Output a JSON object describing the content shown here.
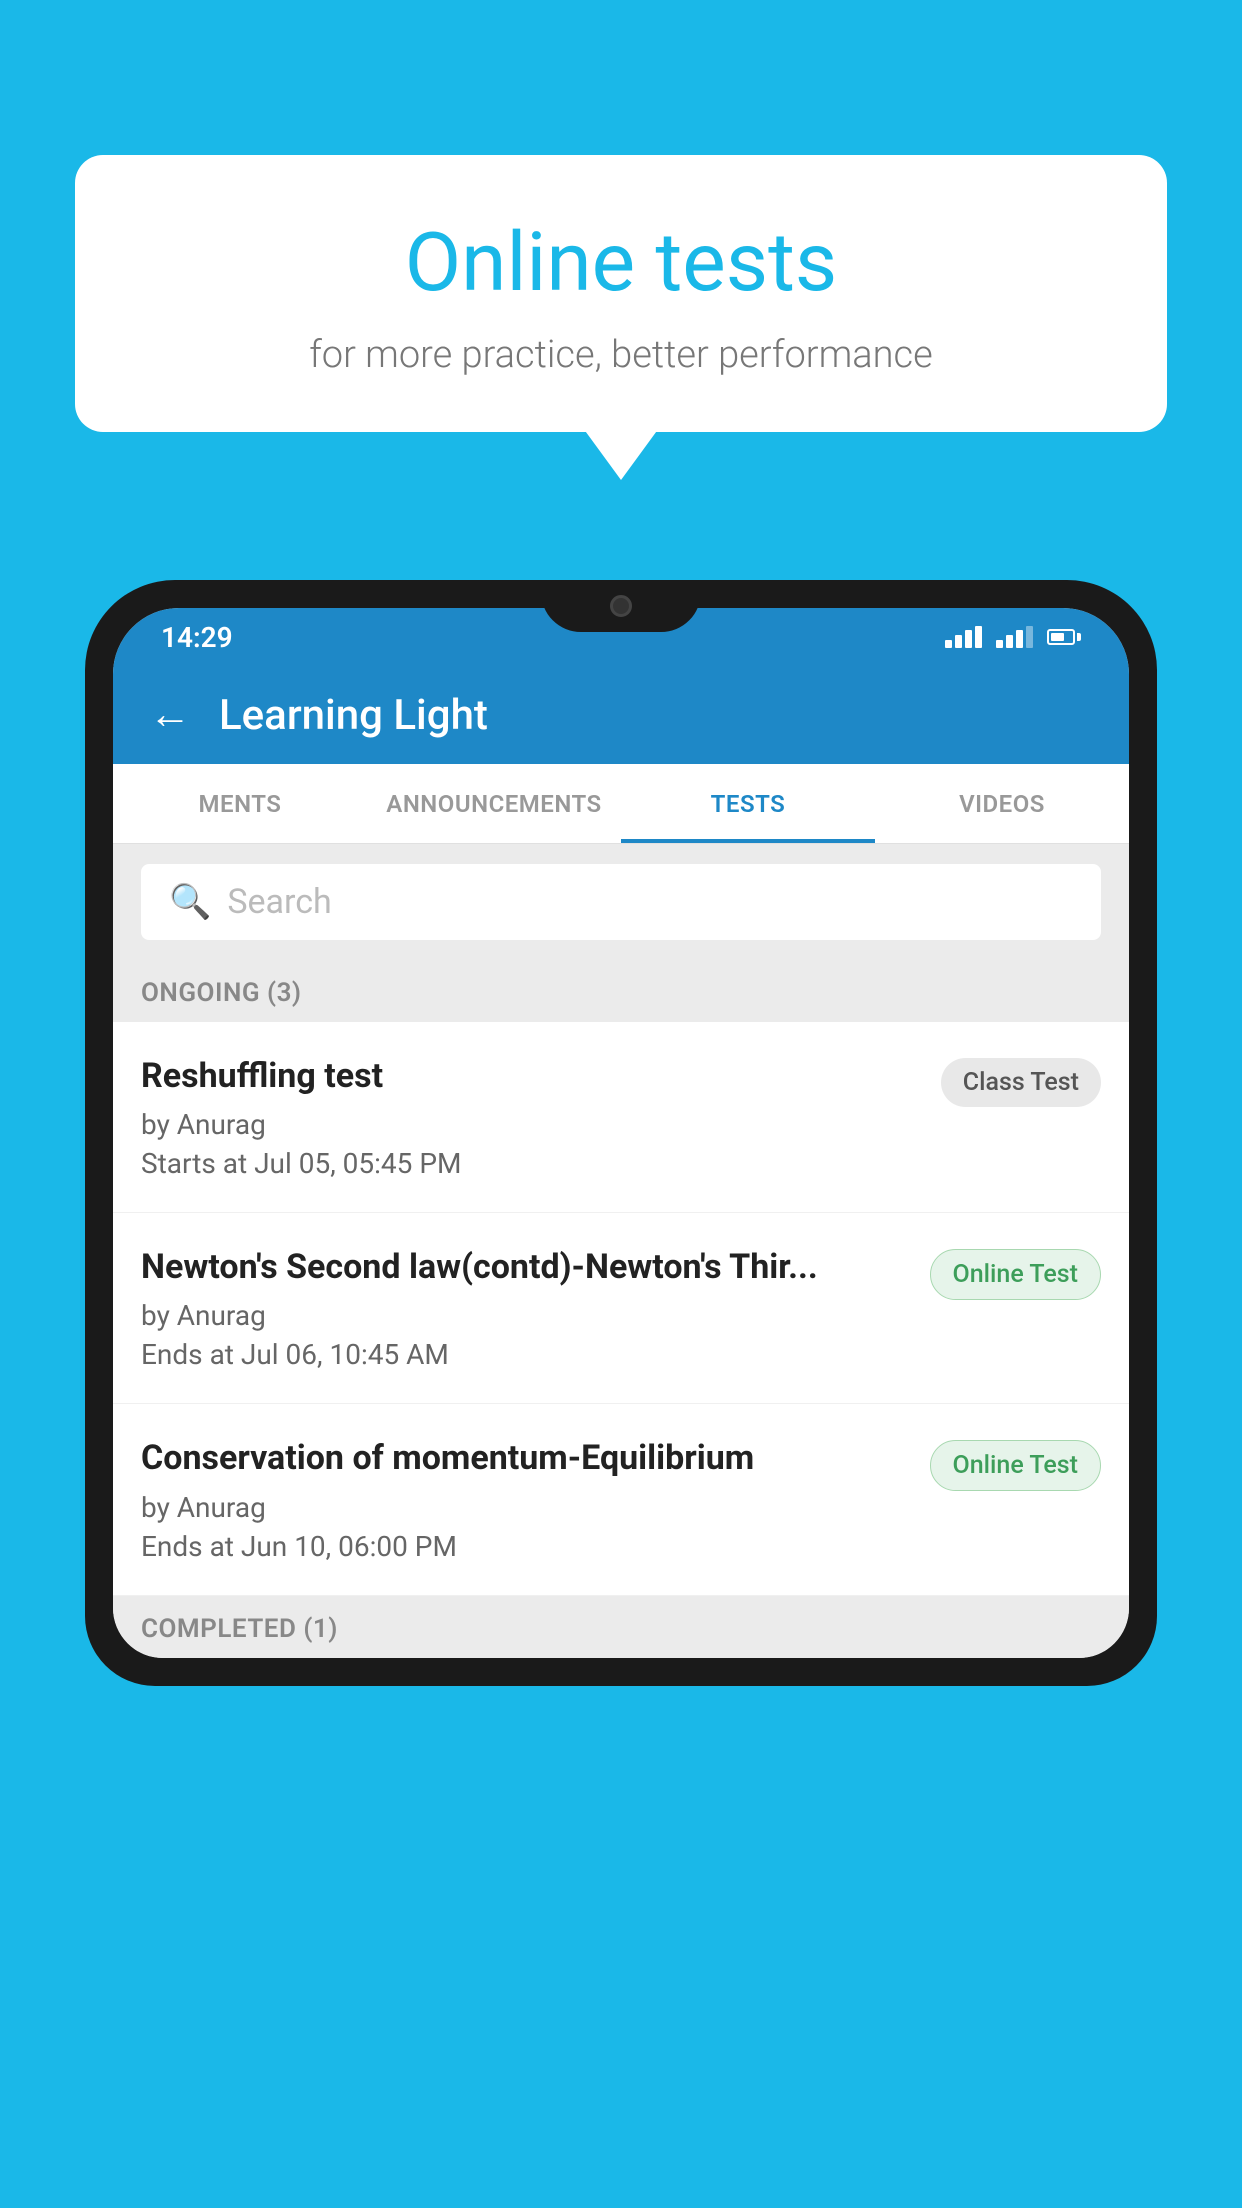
{
  "background_color": "#1ab8e8",
  "speech_bubble": {
    "title": "Online tests",
    "subtitle": "for more practice, better performance"
  },
  "phone": {
    "status_bar": {
      "time": "14:29",
      "wifi": true,
      "signal": true,
      "battery": true
    },
    "header": {
      "title": "Learning Light",
      "back_label": "←"
    },
    "tabs": [
      {
        "label": "MENTS",
        "active": false
      },
      {
        "label": "ANNOUNCEMENTS",
        "active": false
      },
      {
        "label": "TESTS",
        "active": true
      },
      {
        "label": "VIDEOS",
        "active": false
      }
    ],
    "search": {
      "placeholder": "Search"
    },
    "ongoing_section": {
      "label": "ONGOING (3)"
    },
    "tests": [
      {
        "name": "Reshuffling test",
        "author": "by Anurag",
        "date": "Starts at  Jul 05, 05:45 PM",
        "badge": "Class Test",
        "badge_type": "class"
      },
      {
        "name": "Newton's Second law(contd)-Newton's Thir...",
        "author": "by Anurag",
        "date": "Ends at  Jul 06, 10:45 AM",
        "badge": "Online Test",
        "badge_type": "online"
      },
      {
        "name": "Conservation of momentum-Equilibrium",
        "author": "by Anurag",
        "date": "Ends at  Jun 10, 06:00 PM",
        "badge": "Online Test",
        "badge_type": "online"
      }
    ],
    "completed_section": {
      "label": "COMPLETED (1)"
    }
  }
}
